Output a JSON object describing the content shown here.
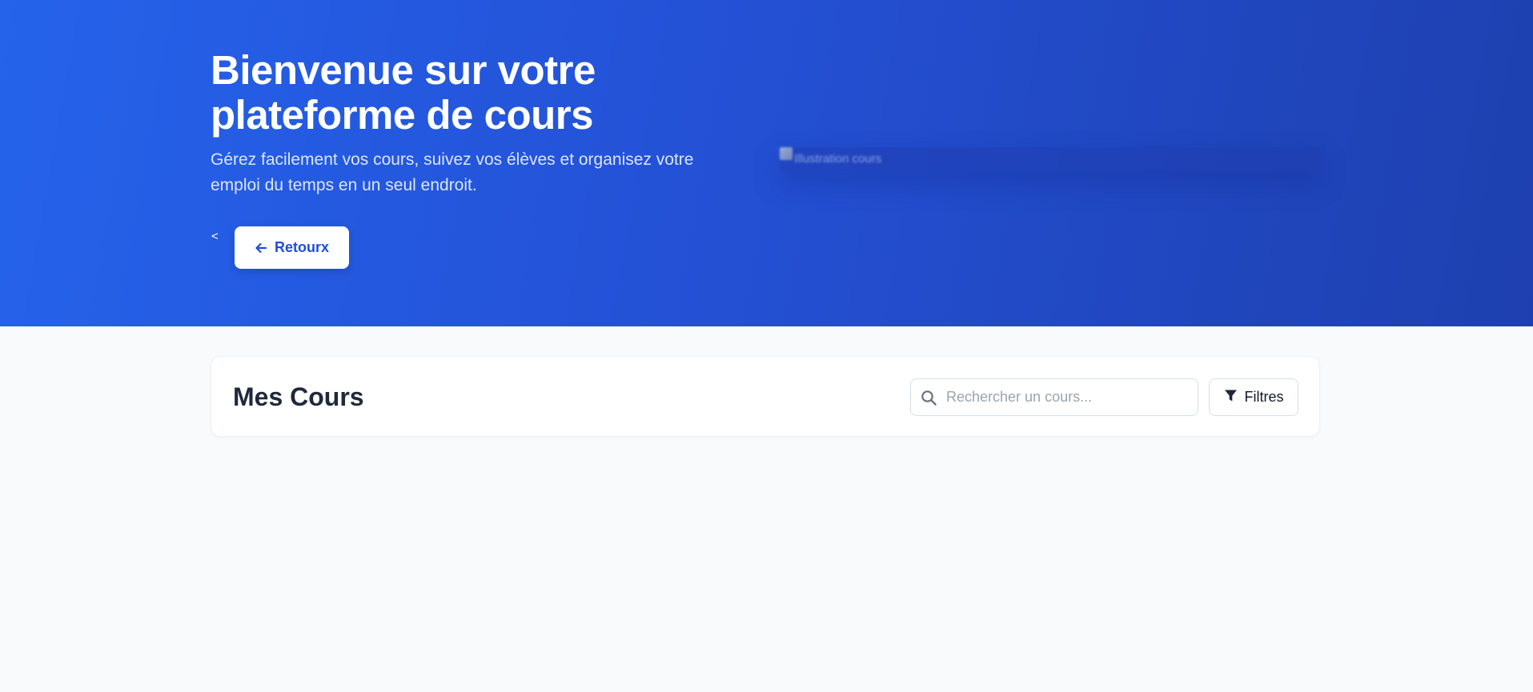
{
  "hero": {
    "title": "Bienvenue sur votre plateforme de cours",
    "subtitle": "Gérez facilement vos cours, suivez vos élèves et organisez votre emploi du temps en un seul endroit.",
    "back_chevron": "<",
    "back_button_label": "Retourx",
    "back_button_icon": "arrow-left-icon",
    "image_alt": "Illustration cours"
  },
  "courses": {
    "title": "Mes Cours",
    "search": {
      "placeholder": "Rechercher un cours...",
      "value": "",
      "icon": "search-icon"
    },
    "filters_label": "Filtres",
    "filters_icon": "filter-icon"
  },
  "colors": {
    "hero_gradient_start": "#2563eb",
    "hero_gradient_end": "#1e40af",
    "accent": "#1d4ed8",
    "page_background": "#f8fafc",
    "card_background": "#ffffff",
    "heading_dark": "#1e293b"
  }
}
